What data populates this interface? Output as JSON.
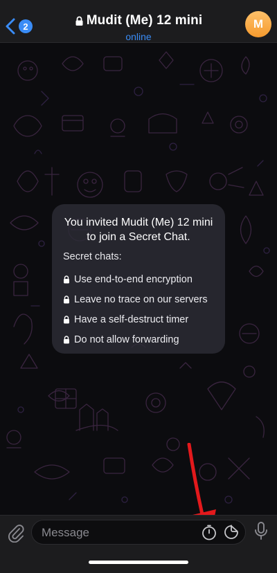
{
  "header": {
    "back_badge": "2",
    "title": "Mudit (Me) 12 mini",
    "status": "online",
    "avatar_initial": "M"
  },
  "secret_chat_info": {
    "title": "You invited Mudit (Me) 12 mini to join a Secret Chat.",
    "subtitle": "Secret chats:",
    "items": [
      "Use end-to-end encryption",
      "Leave no trace on our servers",
      "Have a self-destruct timer",
      "Do not allow forwarding"
    ]
  },
  "input_bar": {
    "placeholder": "Message"
  },
  "colors": {
    "accent": "#3a8cf6",
    "annotation_arrow": "#e3191c",
    "avatar": "#f7a83e"
  },
  "icons": {
    "back": "chevron-left-icon",
    "lock": "lock-icon",
    "attach": "paperclip-icon",
    "timer": "stopwatch-icon",
    "sticker": "sticker-icon",
    "mic": "microphone-icon"
  }
}
